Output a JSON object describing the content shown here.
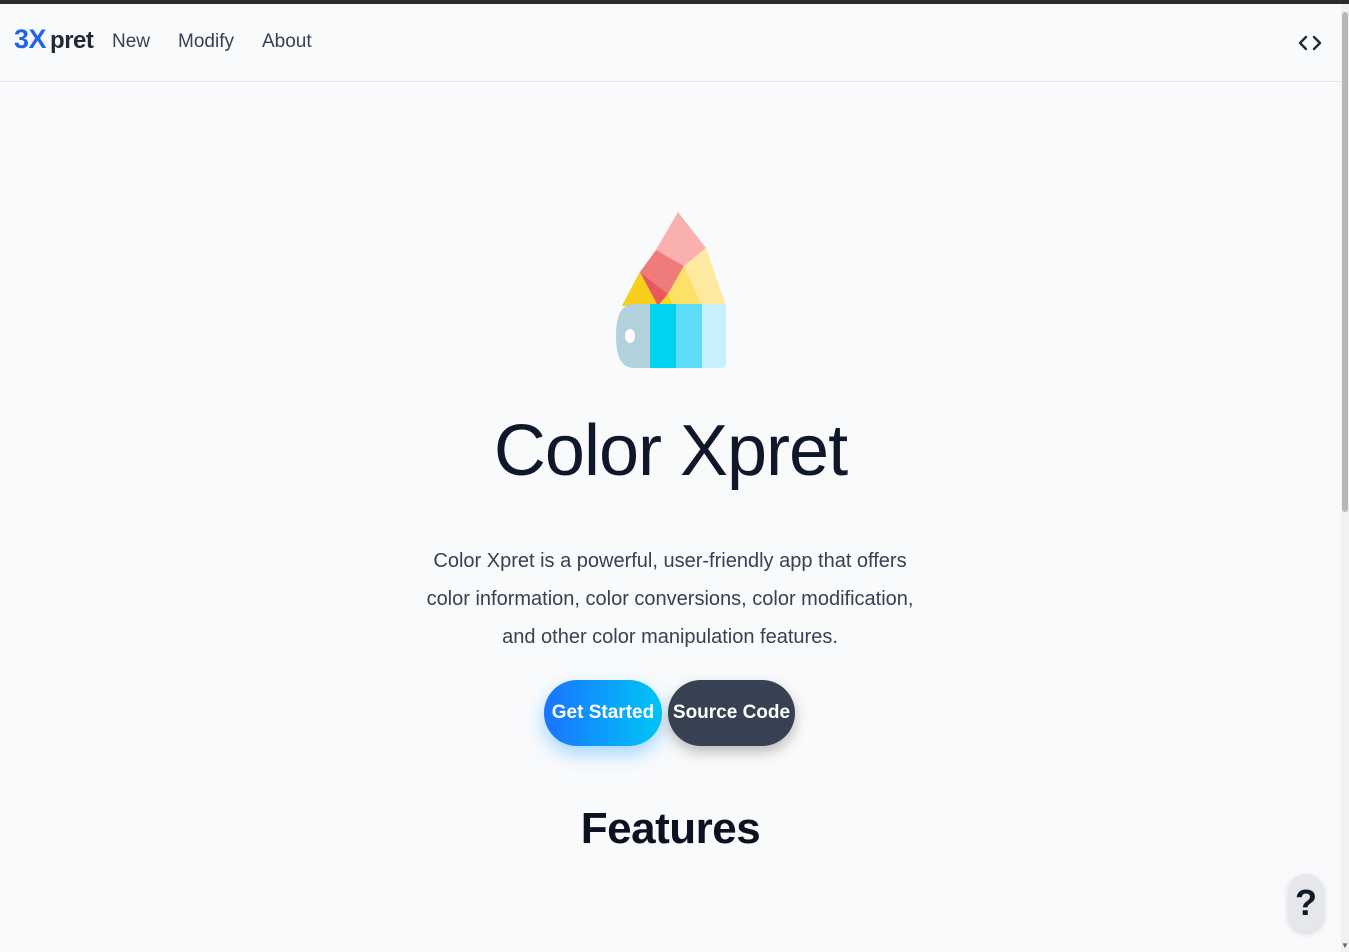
{
  "navbar": {
    "logo_mark": "3X",
    "logo_word": "pret",
    "links": [
      {
        "label": "New"
      },
      {
        "label": "Modify"
      },
      {
        "label": "About"
      }
    ],
    "code_icon": "code-brackets-icon"
  },
  "hero": {
    "icon": "color-palette-swatch-icon",
    "title": "Color Xpret",
    "description": "Color Xpret is a powerful, user-friendly app that offers color information, color conversions, color modification, and other color manipulation features.",
    "primary_button": "Get Started",
    "secondary_button": "Source Code"
  },
  "features": {
    "title": "Features"
  },
  "help_button": "?",
  "colors": {
    "accent_blue": "#1a73ff",
    "accent_cyan": "#00c6f5",
    "dark_button": "#374151",
    "background": "#f8fafc"
  }
}
